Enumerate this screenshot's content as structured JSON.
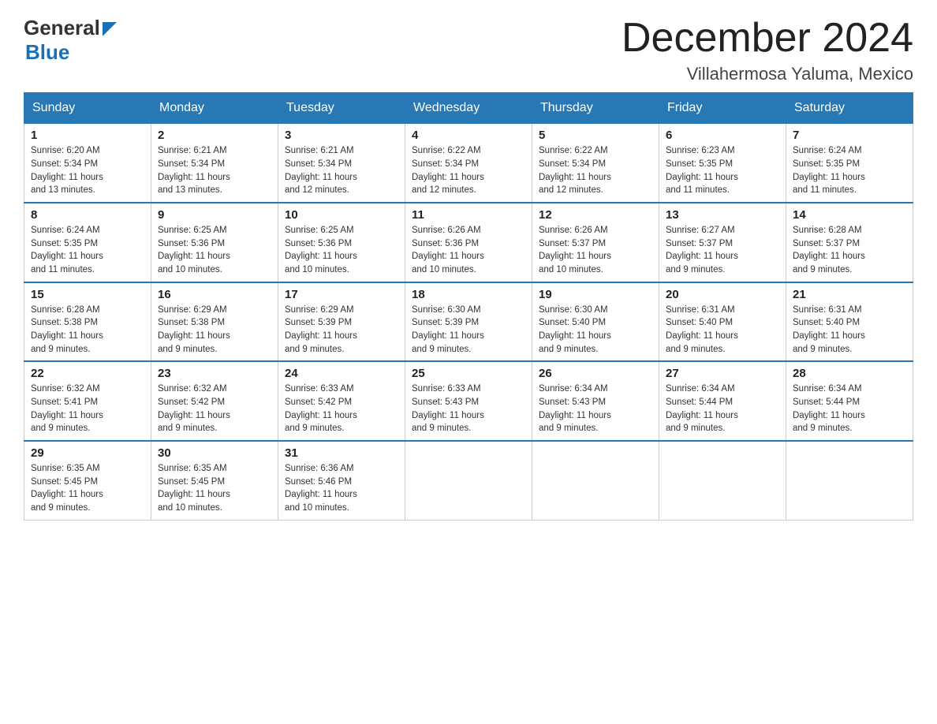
{
  "logo": {
    "general": "General",
    "blue": "Blue"
  },
  "header": {
    "month_year": "December 2024",
    "location": "Villahermosa Yaluma, Mexico"
  },
  "weekdays": [
    "Sunday",
    "Monday",
    "Tuesday",
    "Wednesday",
    "Thursday",
    "Friday",
    "Saturday"
  ],
  "weeks": [
    [
      {
        "day": "1",
        "sunrise": "6:20 AM",
        "sunset": "5:34 PM",
        "daylight": "11 hours and 13 minutes."
      },
      {
        "day": "2",
        "sunrise": "6:21 AM",
        "sunset": "5:34 PM",
        "daylight": "11 hours and 13 minutes."
      },
      {
        "day": "3",
        "sunrise": "6:21 AM",
        "sunset": "5:34 PM",
        "daylight": "11 hours and 12 minutes."
      },
      {
        "day": "4",
        "sunrise": "6:22 AM",
        "sunset": "5:34 PM",
        "daylight": "11 hours and 12 minutes."
      },
      {
        "day": "5",
        "sunrise": "6:22 AM",
        "sunset": "5:34 PM",
        "daylight": "11 hours and 12 minutes."
      },
      {
        "day": "6",
        "sunrise": "6:23 AM",
        "sunset": "5:35 PM",
        "daylight": "11 hours and 11 minutes."
      },
      {
        "day": "7",
        "sunrise": "6:24 AM",
        "sunset": "5:35 PM",
        "daylight": "11 hours and 11 minutes."
      }
    ],
    [
      {
        "day": "8",
        "sunrise": "6:24 AM",
        "sunset": "5:35 PM",
        "daylight": "11 hours and 11 minutes."
      },
      {
        "day": "9",
        "sunrise": "6:25 AM",
        "sunset": "5:36 PM",
        "daylight": "11 hours and 10 minutes."
      },
      {
        "day": "10",
        "sunrise": "6:25 AM",
        "sunset": "5:36 PM",
        "daylight": "11 hours and 10 minutes."
      },
      {
        "day": "11",
        "sunrise": "6:26 AM",
        "sunset": "5:36 PM",
        "daylight": "11 hours and 10 minutes."
      },
      {
        "day": "12",
        "sunrise": "6:26 AM",
        "sunset": "5:37 PM",
        "daylight": "11 hours and 10 minutes."
      },
      {
        "day": "13",
        "sunrise": "6:27 AM",
        "sunset": "5:37 PM",
        "daylight": "11 hours and 9 minutes."
      },
      {
        "day": "14",
        "sunrise": "6:28 AM",
        "sunset": "5:37 PM",
        "daylight": "11 hours and 9 minutes."
      }
    ],
    [
      {
        "day": "15",
        "sunrise": "6:28 AM",
        "sunset": "5:38 PM",
        "daylight": "11 hours and 9 minutes."
      },
      {
        "day": "16",
        "sunrise": "6:29 AM",
        "sunset": "5:38 PM",
        "daylight": "11 hours and 9 minutes."
      },
      {
        "day": "17",
        "sunrise": "6:29 AM",
        "sunset": "5:39 PM",
        "daylight": "11 hours and 9 minutes."
      },
      {
        "day": "18",
        "sunrise": "6:30 AM",
        "sunset": "5:39 PM",
        "daylight": "11 hours and 9 minutes."
      },
      {
        "day": "19",
        "sunrise": "6:30 AM",
        "sunset": "5:40 PM",
        "daylight": "11 hours and 9 minutes."
      },
      {
        "day": "20",
        "sunrise": "6:31 AM",
        "sunset": "5:40 PM",
        "daylight": "11 hours and 9 minutes."
      },
      {
        "day": "21",
        "sunrise": "6:31 AM",
        "sunset": "5:40 PM",
        "daylight": "11 hours and 9 minutes."
      }
    ],
    [
      {
        "day": "22",
        "sunrise": "6:32 AM",
        "sunset": "5:41 PM",
        "daylight": "11 hours and 9 minutes."
      },
      {
        "day": "23",
        "sunrise": "6:32 AM",
        "sunset": "5:42 PM",
        "daylight": "11 hours and 9 minutes."
      },
      {
        "day": "24",
        "sunrise": "6:33 AM",
        "sunset": "5:42 PM",
        "daylight": "11 hours and 9 minutes."
      },
      {
        "day": "25",
        "sunrise": "6:33 AM",
        "sunset": "5:43 PM",
        "daylight": "11 hours and 9 minutes."
      },
      {
        "day": "26",
        "sunrise": "6:34 AM",
        "sunset": "5:43 PM",
        "daylight": "11 hours and 9 minutes."
      },
      {
        "day": "27",
        "sunrise": "6:34 AM",
        "sunset": "5:44 PM",
        "daylight": "11 hours and 9 minutes."
      },
      {
        "day": "28",
        "sunrise": "6:34 AM",
        "sunset": "5:44 PM",
        "daylight": "11 hours and 9 minutes."
      }
    ],
    [
      {
        "day": "29",
        "sunrise": "6:35 AM",
        "sunset": "5:45 PM",
        "daylight": "11 hours and 9 minutes."
      },
      {
        "day": "30",
        "sunrise": "6:35 AM",
        "sunset": "5:45 PM",
        "daylight": "11 hours and 10 minutes."
      },
      {
        "day": "31",
        "sunrise": "6:36 AM",
        "sunset": "5:46 PM",
        "daylight": "11 hours and 10 minutes."
      },
      null,
      null,
      null,
      null
    ]
  ],
  "labels": {
    "sunrise": "Sunrise:",
    "sunset": "Sunset:",
    "daylight": "Daylight:"
  }
}
